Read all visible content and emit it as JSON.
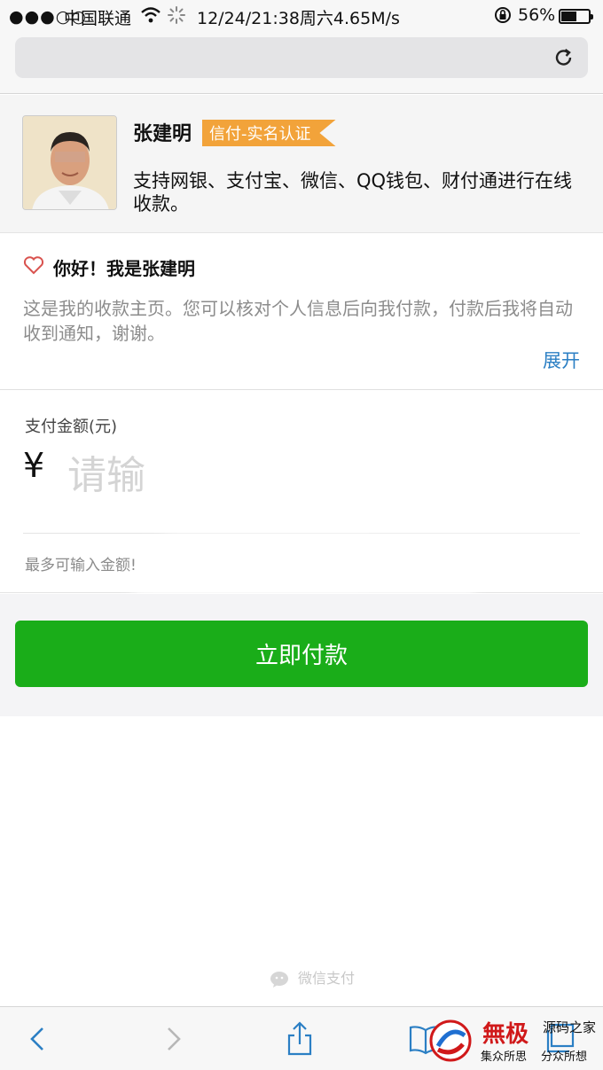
{
  "status_bar": {
    "signal": "●●●○○",
    "carrier": "中国联通",
    "time_speed": "12/24/21:38周六4.65M/s",
    "battery": "56%",
    "battery_level": 0.56
  },
  "profile": {
    "name": "张建明",
    "badge": "信付-实名认证",
    "description": "支持网银、支付宝、微信、QQ钱包、财付通进行在线收款。"
  },
  "greeting": {
    "title": "你好！我是张建明",
    "body": "这是我的收款主页。您可以核对个人信息后向我付款，付款后我将自动收到通知，谢谢。",
    "expand_label": "展开"
  },
  "amount": {
    "label": "支付金额(元)",
    "currency_symbol": "¥",
    "placeholder": "请输",
    "max_hint": "最多可输入金额!"
  },
  "pay_button": {
    "label": "立即付款"
  },
  "footer": {
    "brand": "微信支付"
  },
  "watermark": {
    "big": "無极",
    "small1": "源码之家",
    "small2": "集众所思",
    "small3": "分众所想"
  },
  "colors": {
    "accent_green": "#1aad19",
    "badge_orange": "#f2a33a",
    "link_blue": "#2b7fc4"
  }
}
